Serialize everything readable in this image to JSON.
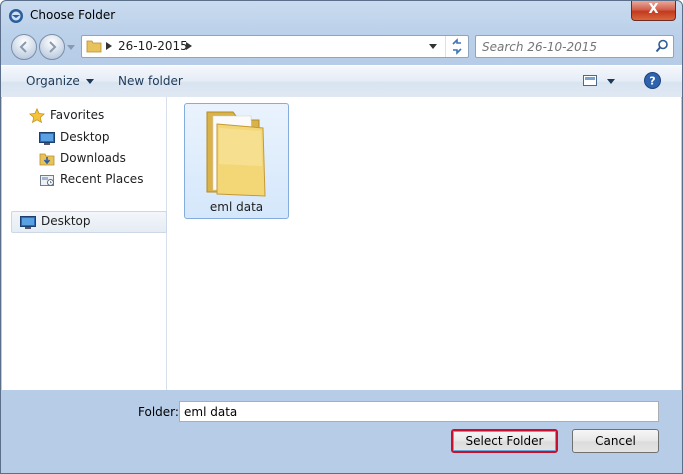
{
  "window": {
    "title": "Choose Folder",
    "close_label": "X"
  },
  "address": {
    "crumb": "26-10-2015",
    "search_placeholder": "Search 26-10-2015"
  },
  "toolbar": {
    "organize": "Organize",
    "new_folder": "New folder"
  },
  "nav": {
    "favorites": "Favorites",
    "items": [
      "Desktop",
      "Downloads",
      "Recent Places"
    ],
    "desktop_root": "Desktop"
  },
  "files": [
    {
      "name": "eml data",
      "icon": "folder-icon",
      "selected": true
    }
  ],
  "footer": {
    "folder_label": "Folder:",
    "folder_value": "eml data",
    "select_button": "Select Folder",
    "cancel_button": "Cancel"
  },
  "colors": {
    "accent_red": "#c8102e",
    "selection_blue": "#84acdd"
  }
}
